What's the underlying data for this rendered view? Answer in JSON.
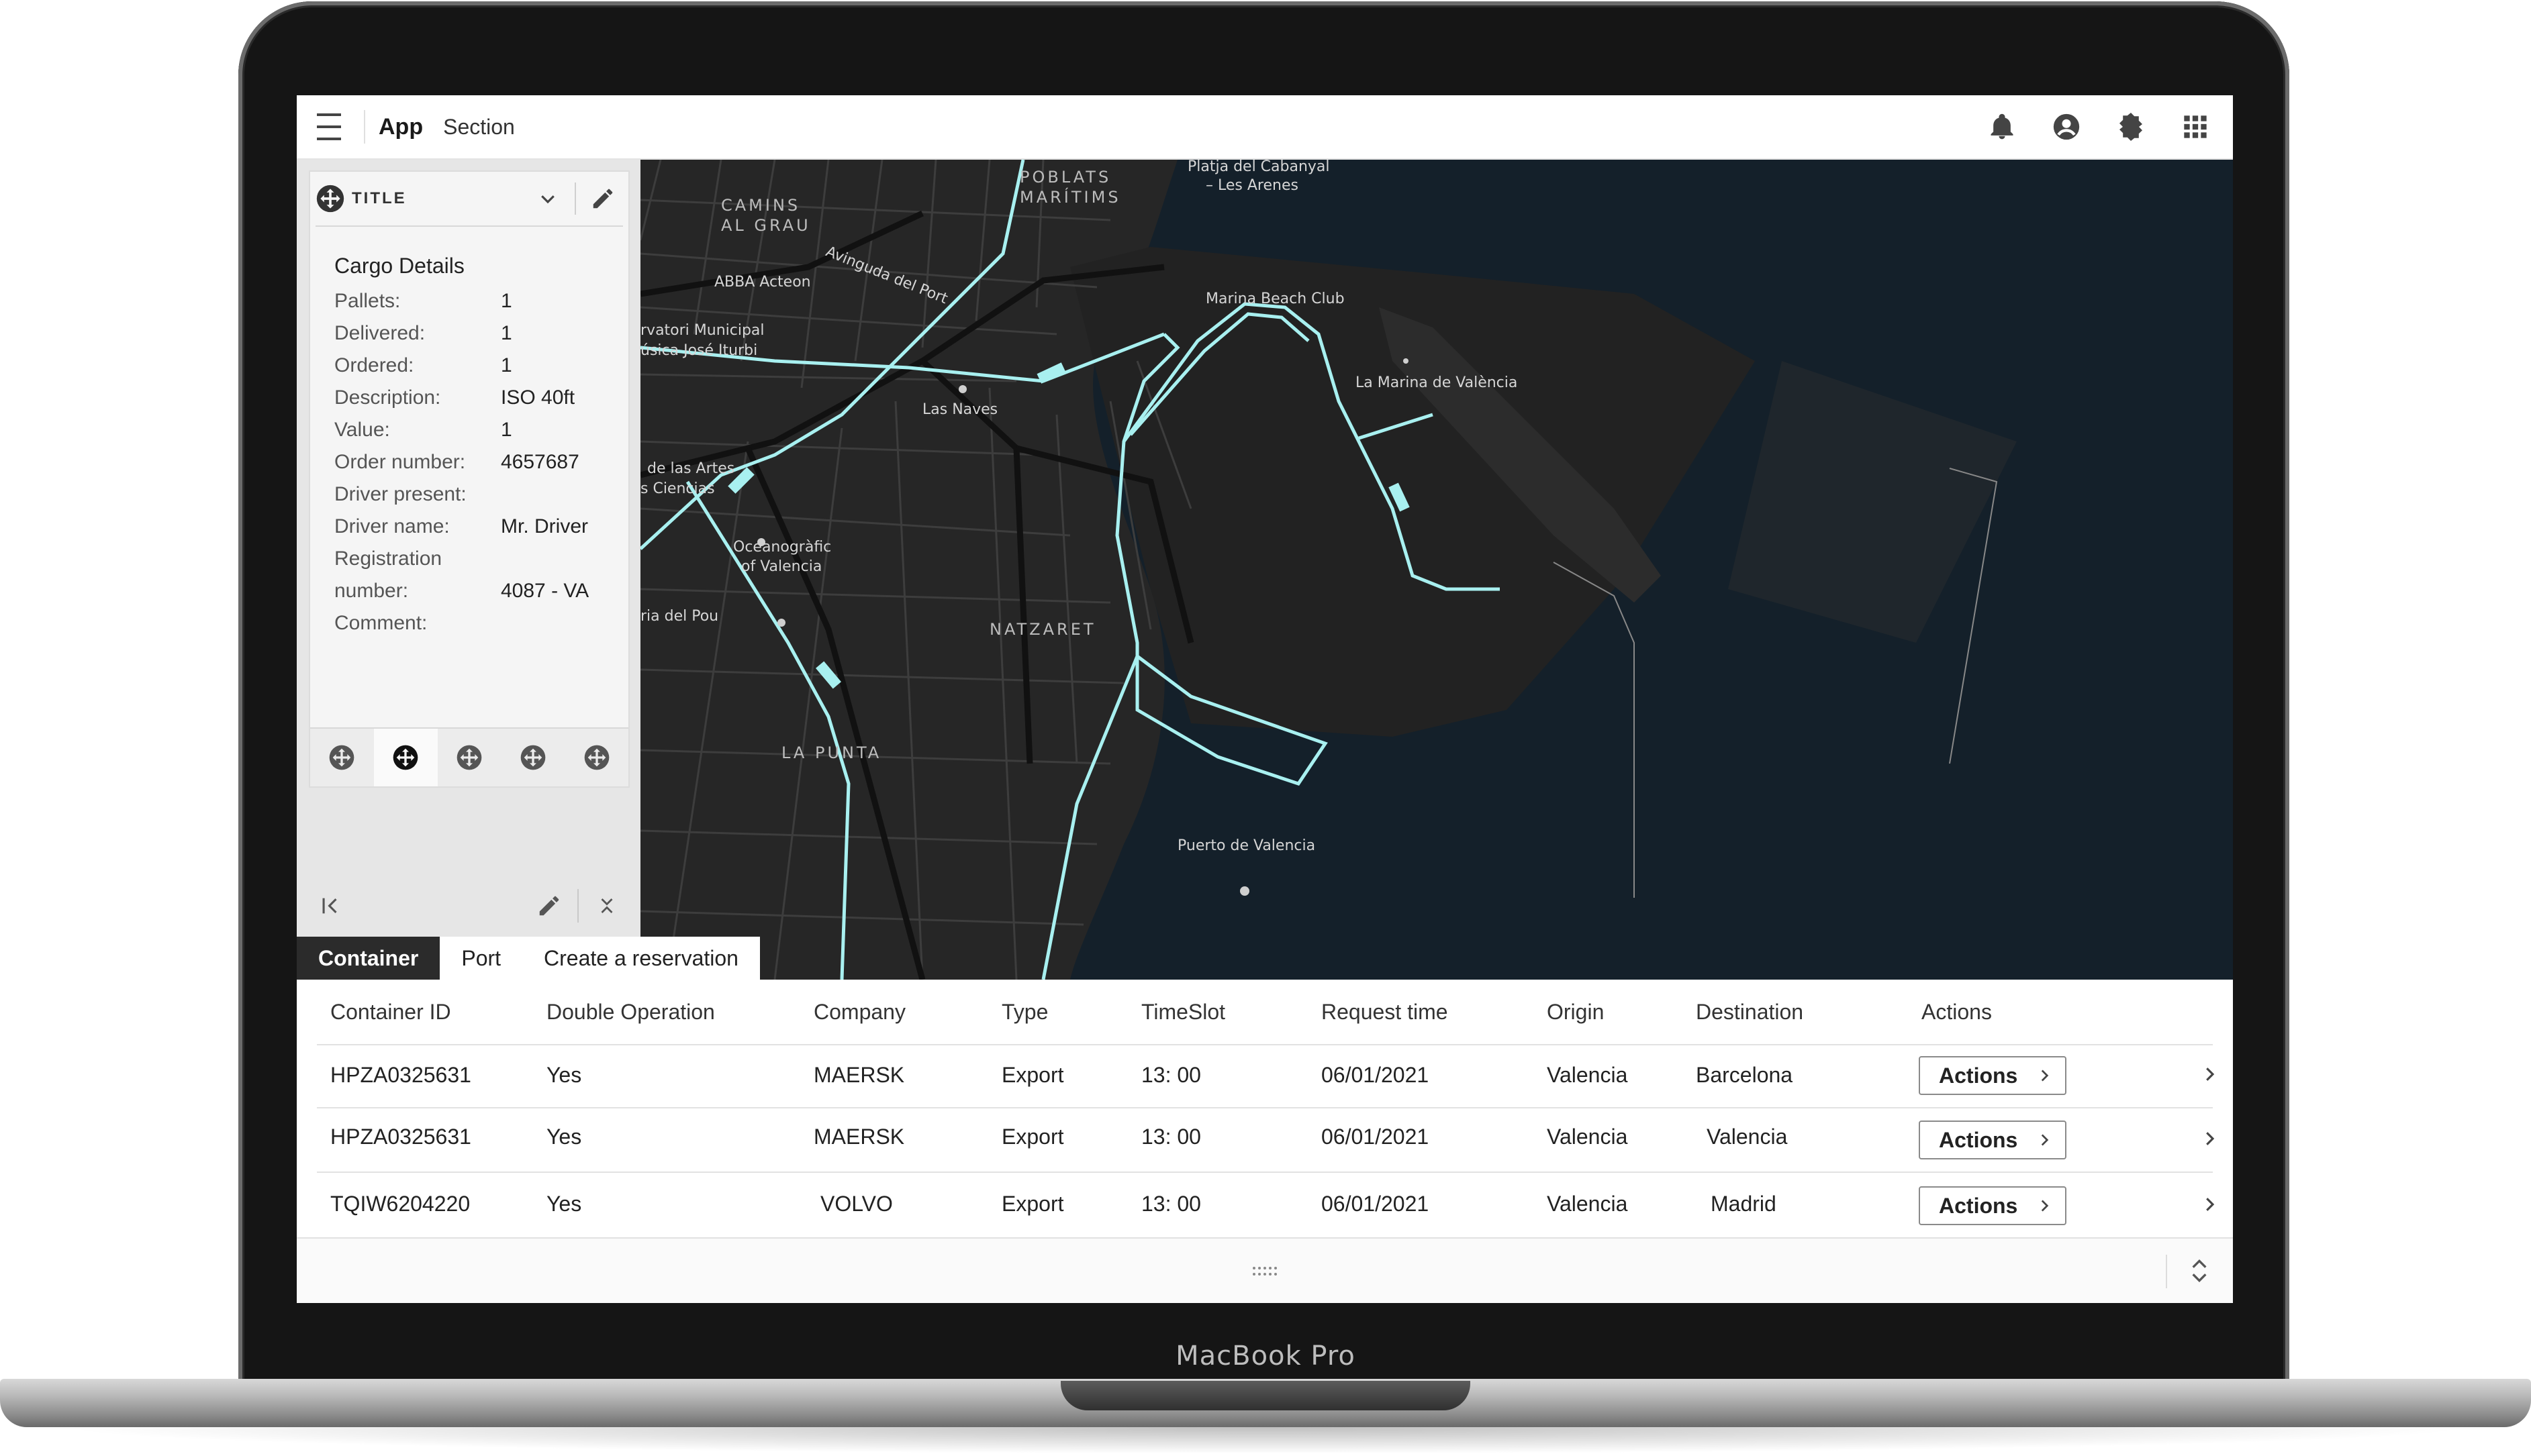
{
  "device": {
    "label": "MacBook Pro"
  },
  "header": {
    "app_name": "App",
    "section": "Section",
    "icons": [
      "menu-icon",
      "bell-icon",
      "account-icon",
      "theme-icon",
      "apps-grid-icon"
    ]
  },
  "map": {
    "labels": {
      "poblats": "POBLATS",
      "maritims": "MARÍTIMS",
      "camins": "CAMINS",
      "al_grau": "AL GRAU",
      "cabanyal_1": "Platja del Cabanyal",
      "cabanyal_2": "– Les Arenes",
      "marina_beach": "Marina Beach Club",
      "la_marina": "La Marina de València",
      "abba": "ABBA Acteon",
      "avinguda": "Avinguda del Port",
      "conservatori_1": "rvatori Municipal",
      "conservatori_2": "úsica José Iturbi",
      "las_naves": "Las Naves",
      "artes_1": "de las Artes",
      "artes_2": "s Ciencias",
      "oceanografic_1": "Oceanogràfic",
      "oceanografic_2": "of Valencia",
      "natzaret": "NATZARET",
      "pou": "ria del Pou",
      "la_punta": "LA PUNTA",
      "puerto": "Puerto de Valencia"
    }
  },
  "card": {
    "title": "TITLE",
    "cargo_title": "Cargo Details",
    "rows": [
      {
        "label": "Pallets:",
        "value": "1"
      },
      {
        "label": "Delivered:",
        "value": "1"
      },
      {
        "label": "Ordered:",
        "value": "1"
      },
      {
        "label": "Description:",
        "value": "ISO 40ft"
      },
      {
        "label": "Value:",
        "value": "1"
      },
      {
        "label": "Order number:",
        "value": "4657687"
      },
      {
        "label": "Driver present:",
        "value": ""
      },
      {
        "label": "Driver name:",
        "value": "Mr. Driver"
      },
      {
        "label": "Registration",
        "value": ""
      },
      {
        "label": "number:",
        "value": "4087 - VA"
      },
      {
        "label": "Comment:",
        "value": ""
      }
    ],
    "toolbar_active_index": 1
  },
  "tabs": [
    {
      "label": "Container",
      "active": true
    },
    {
      "label": "Port",
      "active": false
    },
    {
      "label": "Create a reservation",
      "active": false
    }
  ],
  "table": {
    "columns": [
      "Container ID",
      "Double Operation",
      "Company",
      "Type",
      "TimeSlot",
      "Request time",
      "Origin",
      "Destination",
      "Actions"
    ],
    "action_label": "Actions",
    "rows": [
      [
        "HPZA0325631",
        "Yes",
        "MAERSK",
        "Export",
        "13: 00",
        "06/01/2021",
        "Valencia",
        "Barcelona"
      ],
      [
        "HPZA0325631",
        "Yes",
        "MAERSK",
        "Export",
        "13: 00",
        "06/01/2021",
        "Valencia",
        "Valencia"
      ],
      [
        "TQIW6204220",
        "Yes",
        "VOLVO",
        "Export",
        "13: 00",
        "06/01/2021",
        "Valencia",
        "Madrid"
      ]
    ]
  },
  "colors": {
    "route": "#a8f0f0",
    "water": "#14202a",
    "land": "#262626",
    "active_tab": "#2b2b2b"
  }
}
